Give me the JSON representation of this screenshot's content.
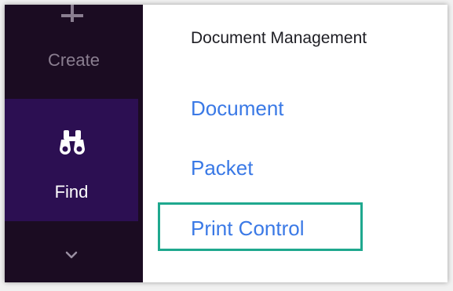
{
  "sidebar": {
    "create": {
      "label": "Create",
      "icon": "plus-icon"
    },
    "find": {
      "label": "Find",
      "icon": "binoculars-icon",
      "active": true
    },
    "more": {
      "icon": "chevron-down-icon"
    }
  },
  "panel": {
    "title": "Document Management",
    "links": [
      {
        "label": "Document"
      },
      {
        "label": "Packet"
      },
      {
        "label": "Print Control",
        "highlighted": true
      }
    ]
  },
  "colors": {
    "sidebar_bg": "#1b0c22",
    "sidebar_active_bg": "#2c0f52",
    "link": "#3a79e6",
    "highlight_border": "#1fa88e"
  }
}
